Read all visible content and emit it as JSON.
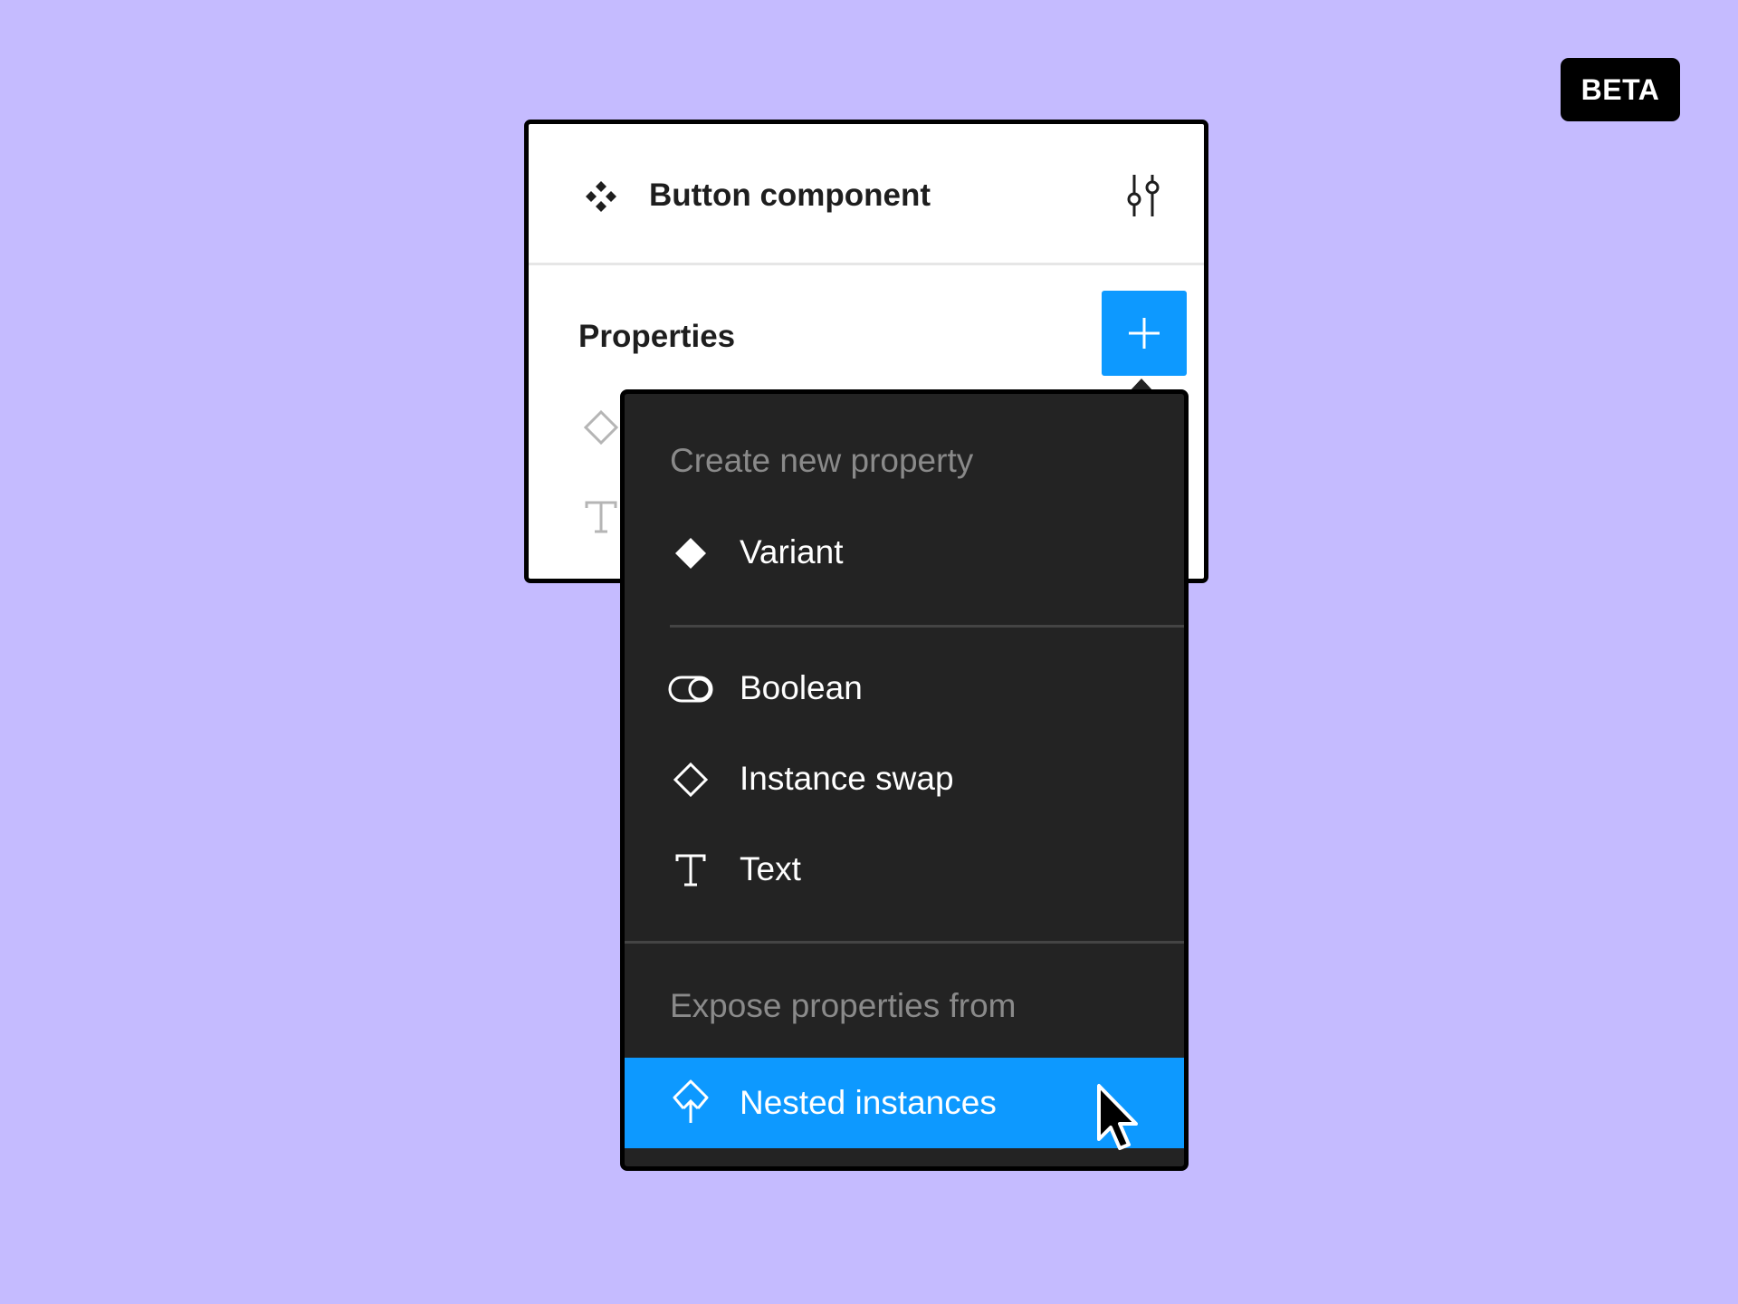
{
  "badge": {
    "label": "BETA"
  },
  "panel": {
    "title": "Button component",
    "properties_title": "Properties"
  },
  "dropdown": {
    "create_header": "Create new property",
    "expose_header": "Expose properties from",
    "items": [
      {
        "label": "Variant",
        "icon": "diamond-filled-icon"
      },
      {
        "label": "Boolean",
        "icon": "toggle-icon"
      },
      {
        "label": "Instance swap",
        "icon": "diamond-outline-icon"
      },
      {
        "label": "Text",
        "icon": "text-icon"
      },
      {
        "label": "Nested instances",
        "icon": "nested-instance-icon",
        "highlighted": true
      }
    ]
  },
  "colors": {
    "background": "#c5bbff",
    "accent": "#0d99ff",
    "menu_background": "#232323",
    "muted_text": "#8a8a8a"
  }
}
